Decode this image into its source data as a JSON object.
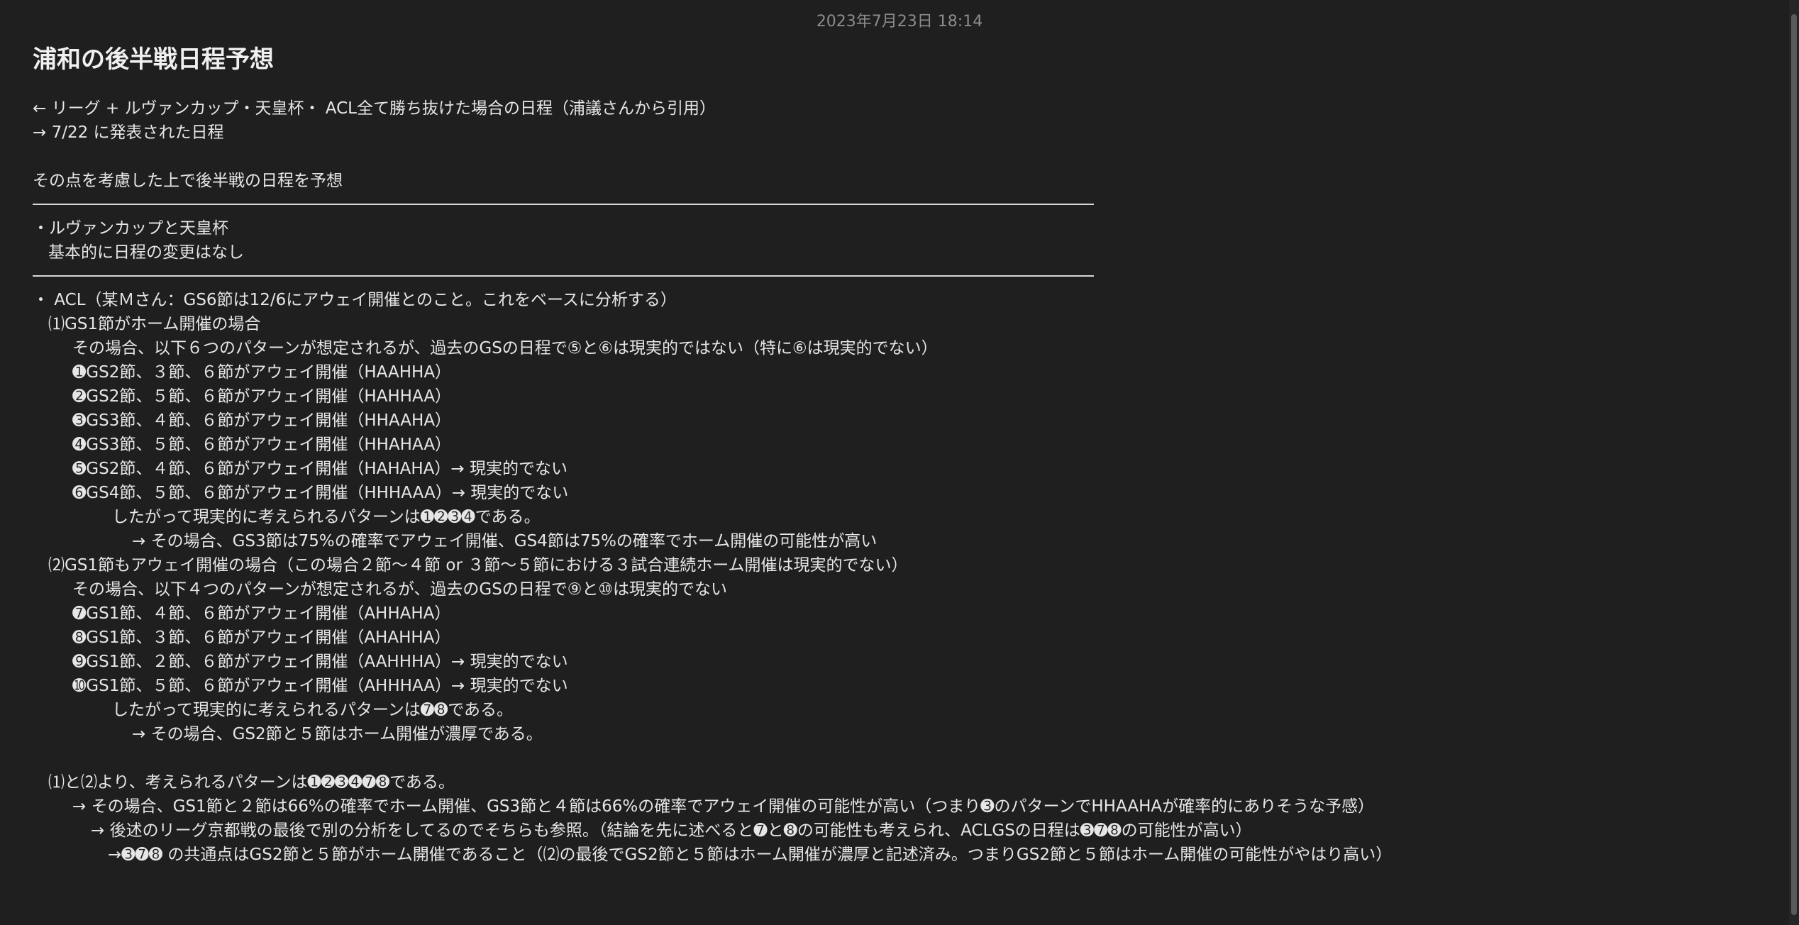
{
  "note": {
    "timestamp": "2023年7月23日 18:14",
    "title": "浦和の後半戦日程予想",
    "lines": [
      "← リーグ + ルヴァンカップ・天皇杯・ ACL全て勝ち抜けた場合の日程（浦議さんから引用）",
      "→ 7/22 に発表された日程",
      "その点を考慮した上で後半戦の日程を予想",
      "・ルヴァンカップと天皇杯",
      "基本的に日程の変更はなし",
      "・ ACL（某Ｍさん：GS6節は12/6にアウェイ開催とのこと。これをベースに分析する）",
      "⑴GS1節がホーム開催の場合",
      "その場合、以下６つのパターンが想定されるが、過去のGSの日程で⑤と⑥は現実的ではない（特に⑥は現実的でない）",
      "➊GS2節、３節、６節がアウェイ開催（HAAHHA）",
      "➋GS2節、５節、６節がアウェイ開催（HAHHAA）",
      "➌GS3節、４節、６節がアウェイ開催（HHAAHA）",
      "➍GS3節、５節、６節がアウェイ開催（HHAHAA）",
      "➎GS2節、４節、６節がアウェイ開催（HAHAHA）→ 現実的でない",
      "➏GS4節、５節、６節がアウェイ開催（HHHAAA）→ 現実的でない",
      "したがって現実的に考えられるパターンは➊➋➌➍である。",
      "→ その場合、GS3節は75%の確率でアウェイ開催、GS4節は75%の確率でホーム開催の可能性が高い",
      "⑵GS1節もアウェイ開催の場合（この場合２節〜４節 or ３節〜５節における３試合連続ホーム開催は現実的でない）",
      "その場合、以下４つのパターンが想定されるが、過去のGSの日程で⑨と⑩は現実的でない",
      "➐GS1節、４節、６節がアウェイ開催（AHHAHA）",
      "➑GS1節、３節、６節がアウェイ開催（AHAHHA）",
      "➒GS1節、２節、６節がアウェイ開催（AAHHHA）→ 現実的でない",
      "➓GS1節、５節、６節がアウェイ開催（AHHHAA）→ 現実的でない",
      "したがって現実的に考えられるパターンは➐➑である。",
      "→ その場合、GS2節と５節はホーム開催が濃厚である。",
      "⑴と⑵より、考えられるパターンは➊➋➌➍➐➑である。",
      "→ その場合、GS1節と２節は66%の確率でホーム開催、GS3節と４節は66%の確率でアウェイ開催の可能性が高い（つまり➌のパターンでHHAAHAが確率的にありそうな予感）",
      "→ 後述のリーグ京都戦の最後で別の分析をしてるのでそちらも参照。（結論を先に述べると➐と➑の可能性も考えられ、ACLGSの日程は➌➐➑の可能性が高い）",
      "→➌➐➑ の共通点はGS2節と５節がホーム開催であること（⑵の最後でGS2節と５節はホーム開催が濃厚と記述済み。つまりGS2節と５節はホーム開催の可能性がやはり高い）"
    ]
  }
}
